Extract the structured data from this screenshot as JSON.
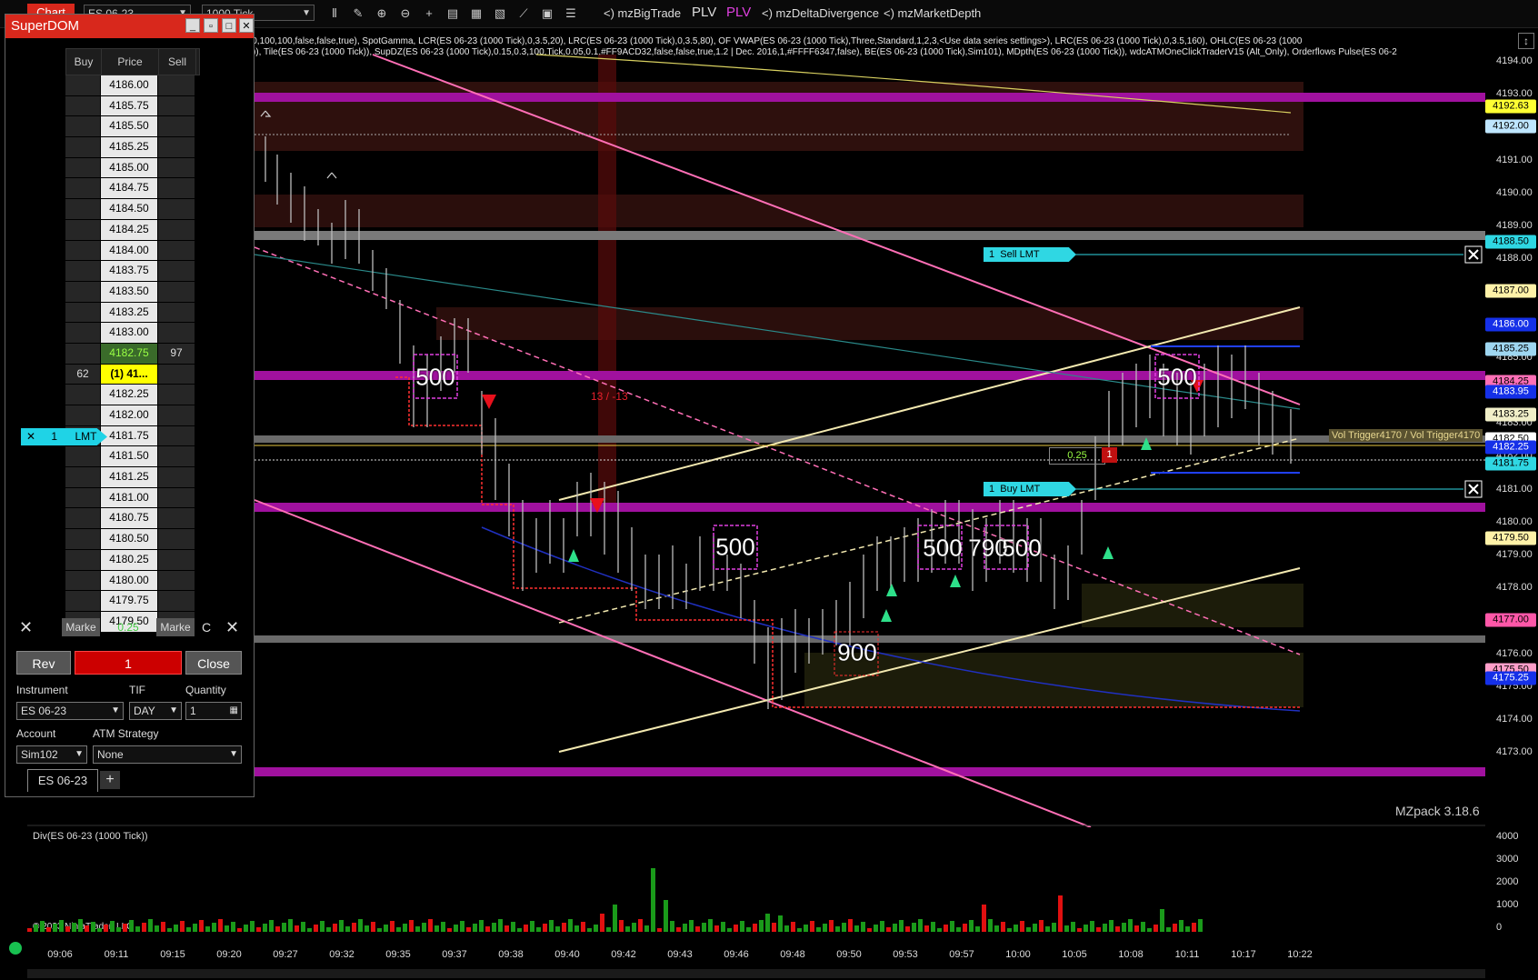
{
  "toolbar": {
    "chart_tab": "Chart",
    "instrument": "ES 06-23",
    "period": "1000 Tick",
    "indicator_tabs": [
      "<) mzBigTrade",
      "PLV",
      "PLV",
      "<) mzDeltaDivergence",
      "<) mzMarketDepth"
    ]
  },
  "legend": {
    "line1": "),100,100,100,false,false,true), SpotGamma, LCR(ES 06-23 (1000 Tick),0,3.5,20), LRC(ES 06-23 (1000 Tick),0,3.5,80), OF VWAP(ES 06-23 (1000 Tick),Three,Standard,1,2,3,<Use data series settings>), LRC(ES 06-23 (1000 Tick),0,3.5,160), OHLC(ES 06-23 (1000",
    "line2": "Tick)), Tile(ES 06-23 (1000 Tick)), SupDZ(ES 06-23 (1000 Tick),0.15,0.3,100,Tick,0.05,0.1,#FF9ACD32,false,false,true,1.2 | Dec. 2016,1,#FFFF6347,false), BE(ES 06-23 (1000 Tick),Sim101), MDpth(ES 06-23 (1000 Tick)), wdcATMOneClickTraderV15 (Alt_Only),  Orderflows Pulse(ES 06-2"
  },
  "superdom": {
    "title": "SuperDOM",
    "headers": {
      "buy": "Buy",
      "price": "Price",
      "sell": "Sell"
    },
    "rows": [
      {
        "price": "4186.00",
        "buy": "",
        "sell": ""
      },
      {
        "price": "4185.75",
        "buy": "",
        "sell": ""
      },
      {
        "price": "4185.50",
        "buy": "",
        "sell": ""
      },
      {
        "price": "4185.25",
        "buy": "",
        "sell": ""
      },
      {
        "price": "4185.00",
        "buy": "",
        "sell": ""
      },
      {
        "price": "4184.75",
        "buy": "",
        "sell": ""
      },
      {
        "price": "4184.50",
        "buy": "",
        "sell": ""
      },
      {
        "price": "4184.25",
        "buy": "",
        "sell": ""
      },
      {
        "price": "4184.00",
        "buy": "",
        "sell": ""
      },
      {
        "price": "4183.75",
        "buy": "",
        "sell": ""
      },
      {
        "price": "4183.50",
        "buy": "",
        "sell": ""
      },
      {
        "price": "4183.25",
        "buy": "",
        "sell": ""
      },
      {
        "price": "4183.00",
        "buy": "",
        "sell": ""
      },
      {
        "price": "4182.75",
        "buy": "",
        "sell": "97",
        "state": "last"
      },
      {
        "price": "(1) 41...",
        "buy": "62",
        "sell": "",
        "state": "cur"
      },
      {
        "price": "4182.25",
        "buy": "",
        "sell": ""
      },
      {
        "price": "4182.00",
        "buy": "",
        "sell": ""
      },
      {
        "price": "4181.75",
        "buy": "",
        "sell": ""
      },
      {
        "price": "4181.50",
        "buy": "",
        "sell": ""
      },
      {
        "price": "4181.25",
        "buy": "",
        "sell": ""
      },
      {
        "price": "4181.00",
        "buy": "",
        "sell": ""
      },
      {
        "price": "4180.75",
        "buy": "",
        "sell": ""
      },
      {
        "price": "4180.50",
        "buy": "",
        "sell": ""
      },
      {
        "price": "4180.25",
        "buy": "",
        "sell": ""
      },
      {
        "price": "4180.00",
        "buy": "",
        "sell": ""
      },
      {
        "price": "4179.75",
        "buy": "",
        "sell": ""
      },
      {
        "price": "4179.50",
        "buy": "",
        "sell": ""
      }
    ],
    "lmt_order": {
      "qty": "1",
      "label": "LMT"
    },
    "bottom_row": {
      "left": "Marke",
      "mid": "0.25",
      "right": "Marke",
      "c": "C"
    },
    "buttons": {
      "rev": "Rev",
      "qty": "1",
      "close": "Close"
    },
    "labels": {
      "instrument": "Instrument",
      "tif": "TIF",
      "quantity": "Quantity",
      "account": "Account",
      "atm": "ATM Strategy"
    },
    "values": {
      "instrument": "ES 06-23",
      "tif": "DAY",
      "quantity": "1",
      "account": "Sim102",
      "atm": "None"
    },
    "tab": "ES 06-23"
  },
  "price_axis": {
    "labels": [
      "4194.00",
      "4193.00",
      "4192.00",
      "4191.00",
      "4190.00",
      "4189.00",
      "4188.00",
      "4187.00",
      "4186.00",
      "4185.00",
      "4184.00",
      "4183.00",
      "4182.00",
      "4181.00",
      "4180.00",
      "4179.00",
      "4178.00",
      "4177.00",
      "4176.00",
      "4175.00",
      "4174.00",
      "4173.00"
    ],
    "badges": [
      {
        "value": "4192.63",
        "bg": "#ffff33",
        "fg": "#000"
      },
      {
        "value": "4192.00",
        "bg": "#bfe6ff",
        "fg": "#000"
      },
      {
        "value": "4188.50",
        "bg": "#2fd7e3",
        "fg": "#000"
      },
      {
        "value": "4187.00",
        "bg": "#fff2a8",
        "fg": "#000"
      },
      {
        "value": "4186.00",
        "bg": "#1530e8",
        "fg": "#fff"
      },
      {
        "value": "4185.25",
        "bg": "#9ed6f0",
        "fg": "#000"
      },
      {
        "value": "4184.25",
        "bg": "#ff6fb6",
        "fg": "#000"
      },
      {
        "value": "4183.95",
        "bg": "#1530e8",
        "fg": "#fff"
      },
      {
        "value": "4183.25",
        "bg": "#f1efc8",
        "fg": "#000"
      },
      {
        "value": "4182.50",
        "bg": "#ffffff",
        "fg": "#000"
      },
      {
        "value": "4182.25",
        "bg": "#1530e8",
        "fg": "#fff"
      },
      {
        "value": "4181.75",
        "bg": "#2fd7e3",
        "fg": "#000"
      },
      {
        "value": "4179.50",
        "bg": "#fff2a8",
        "fg": "#000"
      },
      {
        "value": "4177.00",
        "bg": "#ff57a8",
        "fg": "#000"
      },
      {
        "value": "4175.50",
        "bg": "#ff9ec9",
        "fg": "#000"
      },
      {
        "value": "4175.25",
        "bg": "#1530e8",
        "fg": "#fff"
      }
    ]
  },
  "orders": {
    "sell": {
      "qty": "1",
      "label": "Sell LMT"
    },
    "buy": {
      "qty": "1",
      "label": "Buy LMT"
    }
  },
  "chart_labels": {
    "trade_sizes": [
      "500",
      "500",
      "500",
      "500",
      "790",
      "500",
      "900"
    ],
    "ratio": "13 / -13",
    "vol_trigger": "Vol Trigger4170 / Vol Trigger4170",
    "tick": "0.25",
    "tick_qty": "1",
    "watermark": "MZpack 3.18.6"
  },
  "subpanel": {
    "title": "Div(ES 06-23 (1000 Tick))",
    "copyright": "© 2023 NinjaTrader, LLC",
    "yticks": [
      "4000",
      "3000",
      "2000",
      "1000",
      "0"
    ]
  },
  "time_axis": [
    "09:06",
    "09:11",
    "09:15",
    "09:20",
    "09:27",
    "09:32",
    "09:35",
    "09:37",
    "09:38",
    "09:40",
    "09:42",
    "09:43",
    "09:46",
    "09:48",
    "09:50",
    "09:53",
    "09:57",
    "10:00",
    "10:05",
    "10:08",
    "10:11",
    "10:17",
    "10:22"
  ]
}
